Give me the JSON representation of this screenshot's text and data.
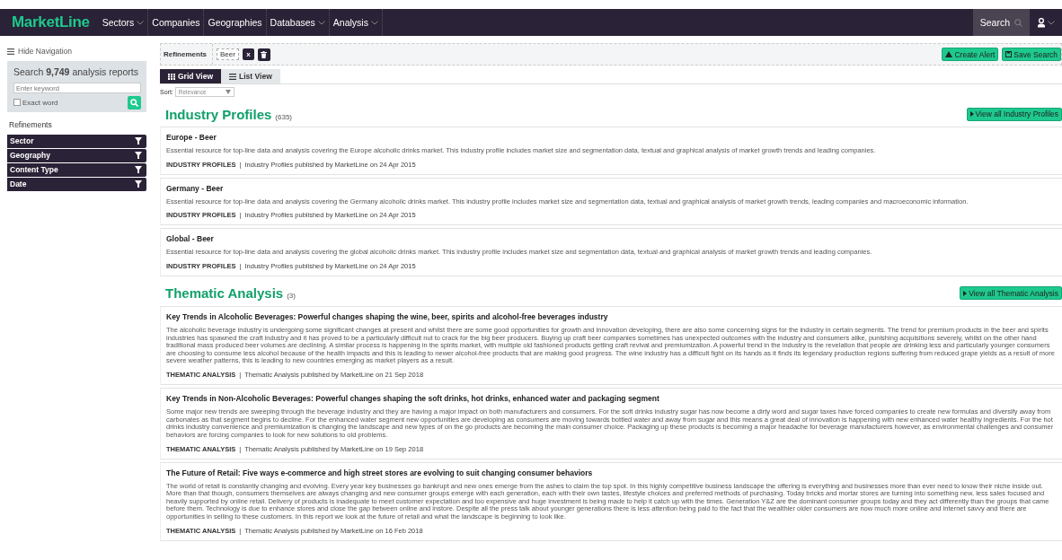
{
  "logo": "MarketLine",
  "nav": [
    {
      "label": "Sectors",
      "has_menu": true
    },
    {
      "label": "Companies",
      "has_menu": false
    },
    {
      "label": "Geographies",
      "has_menu": false
    },
    {
      "label": "Databases",
      "has_menu": true
    },
    {
      "label": "Analysis",
      "has_menu": true
    }
  ],
  "search_button": "Search",
  "sidebar": {
    "hide_nav": "Hide Navigation",
    "search_title": "Search **9,749** analysis reports",
    "keyword": {
      "placeholder": "Enter keyword"
    },
    "exact_word": {
      "label": "Exact word",
      "checked": false
    },
    "refinements_title": "Refinements",
    "filters": [
      "Sector",
      "Geography",
      "Content Type",
      "Date"
    ]
  },
  "refinements": {
    "label": "Refinements",
    "tags": [
      "Beer"
    ],
    "remove": "x",
    "create_alert": "Create Alert",
    "save_search": "Save Search"
  },
  "view_tabs": [
    {
      "label": "Grid View",
      "kind": "grid",
      "selected": true
    },
    {
      "label": "List View",
      "kind": "list",
      "selected": false
    }
  ],
  "sort": {
    "label": "Sort:",
    "value": "Relevance"
  },
  "meta_separator": "|",
  "sections": [
    {
      "title": "Industry Profiles",
      "count": "(635)",
      "view_all": "View all Industry Profiles",
      "items": [
        {
          "title": "Europe - Beer",
          "description": "Essential resource for top-line data and analysis covering the Europe alcoholic drinks market. This industry profile includes market size and segmentation data, textual and graphical analysis of market growth trends and leading companies.",
          "type": "INDUSTRY PROFILES",
          "published": "Industry Profiles published by MarketLine on 24 Apr 2015"
        },
        {
          "title": "Germany - Beer",
          "description": "Essential resource for top-line data and analysis covering the Germany alcoholic drinks market. This industry profile includes market size and segmentation data, textual and graphical analysis of market growth trends, leading companies and macroeconomic information.",
          "type": "INDUSTRY PROFILES",
          "published": "Industry Profiles published by MarketLine on 24 Apr 2015"
        },
        {
          "title": "Global - Beer",
          "description": "Essential resource for top-line data and analysis covering the global alcoholic drinks market. This industry profile includes market size and segmentation data, textual and graphical analysis of market growth trends and leading companies.",
          "type": "INDUSTRY PROFILES",
          "published": "Industry Profiles published by MarketLine on 24 Apr 2015"
        }
      ]
    },
    {
      "title": "Thematic Analysis",
      "count": "(3)",
      "view_all": "View all Thematic Analysis",
      "items": [
        {
          "title": "Key Trends in Alcoholic Beverages: Powerful changes shaping the wine, beer, spirits and alcohol-free beverages industry",
          "description": "The alcoholic beverage industry is undergoing some significant changes at present and whilst there are some good opportunities for growth and innovation developing, there are also some concerning signs for the industry in certain segments. The trend for premium products in the beer and spirits industries has spawned the craft industry and it has proved to be a particularly difficult nut to crack for the big beer producers. Buying up craft beer companies sometimes has unexpected outcomes with the industry and consumers alike, punishing acquisitions severely, whilst on the other hand traditional mass produced beer volumes are declining. A similar process is happening in the spirits market, with multiple old fashioned products getting craft revival and premiumization. A powerful trend in the industry is the revelation that people are drinking less and particularly younger consumers are choosing to consume less alcohol because of the health impacts and this is leading to newer alcohol-free products that are making good progress. The wine industry has a difficult fight on its hands as it finds its legendary production regions suffering from reduced grape yields as a result of more severe weather patterns, this is leading to new countries emerging as market players as a result.",
          "type": "THEMATIC ANALYSIS",
          "published": "Thematic Analysis published by MarketLine on 21 Sep 2018"
        },
        {
          "title": "Key Trends in Non-Alcoholic Beverages: Powerful changes shaping the soft drinks, hot drinks, enhanced water and packaging segment",
          "description": "Some major new trends are sweeping through the beverage industry and they are having a major impact on both manufacturers and consumers. For the soft drinks industry sugar has now become a dirty word and sugar taxes have forced companies to create new formulas and diversify away from carbonates as that segment begins to decline. For the enhanced water segment new opportunities are developing as consumers are moving towards bottled water and away from sugar and this means a great deal of innovation is happening with new enhanced water healthy ingredients. For the hot drinks industry convenience and premiumization is changing the landscape and new types of on the go products are becoming the main consumer choice. Packaging up these products is becoming a major headache for beverage manufacturers however, as environmental challenges and consumer behaviors are forcing companies to look for new solutions to old problems.",
          "type": "THEMATIC ANALYSIS",
          "published": "Thematic Analysis published by MarketLine on 19 Sep 2018"
        },
        {
          "title": "The Future of Retail: Five ways e-commerce and high street stores are evolving to suit changing consumer behaviors",
          "description": "The world of retail is constantly changing and evolving. Every year key businesses go bankrupt and new ones emerge from the ashes to claim the top spot. In this highly competitive business landscape the offering is everything and businesses more than ever need to know their niche inside out. More than that though, consumers themselves are always changing and new consumer groups emerge with each generation, each with their own tastes, lifestyle choices and preferred methods of purchasing. Today bricks and mortar stores are turning into something new, less sales focused and heavily supported by online retail. Delivery of products is inadequate to meet customer expectation and too expensive and huge investment is being made to help it catch up with the times. Generation Y&Z are the dominant consumer groups today and they act differently than the groups that came before them. Technology is due to enhance stores and close the gap between online and instore. Despite all the press talk about younger generations there is less attention being paid to the fact that the wealthier older consumers are now much more online and internet savvy and there are opportunities in selling to these customers. In this report we look at the future of retail and what the landscape is beginning to look like.",
          "type": "THEMATIC ANALYSIS",
          "published": "Thematic Analysis published by MarketLine on 16 Feb 2018"
        }
      ]
    }
  ]
}
